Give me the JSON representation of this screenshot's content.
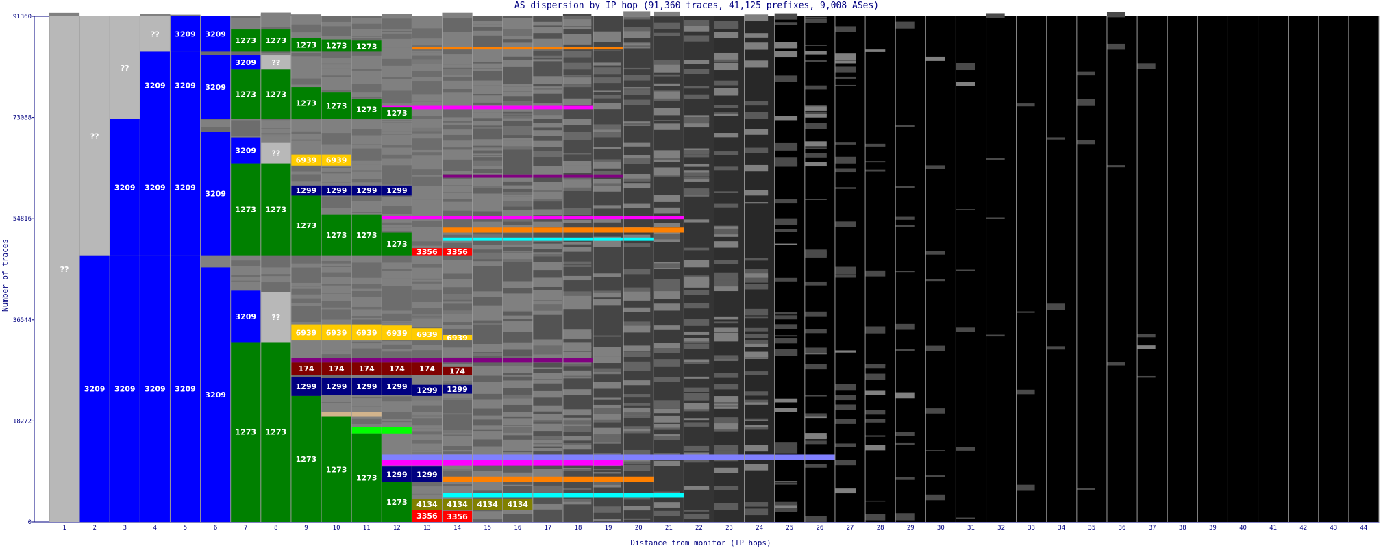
{
  "chart_data": {
    "type": "bar",
    "title": "AS dispersion by IP hop (91,360 traces, 41,125 prefixes, 9,008 ASes)",
    "xlabel": "Distance from monitor (IP hops)",
    "ylabel": "Number of traces",
    "ylim": [
      0,
      91360
    ],
    "y_ticks": [
      "0",
      "18272",
      "36544",
      "54816",
      "73088",
      "91360"
    ],
    "categories": [
      "1",
      "2",
      "3",
      "4",
      "5",
      "6",
      "7",
      "8",
      "9",
      "10",
      "11",
      "12",
      "13",
      "14",
      "15",
      "16",
      "17",
      "18",
      "19",
      "20",
      "21",
      "22",
      "23",
      "24",
      "25",
      "26",
      "27",
      "28",
      "29",
      "30",
      "31",
      "32",
      "33",
      "34",
      "35",
      "36",
      "37",
      "38",
      "39",
      "40",
      "41",
      "42",
      "43",
      "44"
    ],
    "colors": {
      "unknown": "#b8b8b8",
      "as3209": "#0000ff",
      "as1273": "#008000",
      "as6939": "#ffcc00",
      "as174": "#800000",
      "as1299": "#000080",
      "as4134": "#808000",
      "as3356": "#ff0000",
      "other_as": "#808080",
      "no_data": "#000000"
    },
    "labeled_segments": [
      {
        "hop": 1,
        "as": "??",
        "from": 0,
        "to": 91360
      },
      {
        "hop": 2,
        "as": "3209",
        "from": 0,
        "to": 48200
      },
      {
        "hop": 2,
        "as": "??",
        "from": 48200,
        "to": 91360
      },
      {
        "hop": 3,
        "as": "3209",
        "from": 0,
        "to": 48200
      },
      {
        "hop": 3,
        "as": "3209",
        "from": 48200,
        "to": 72800
      },
      {
        "hop": 3,
        "as": "??",
        "from": 72800,
        "to": 91360
      },
      {
        "hop": 4,
        "as": "3209",
        "from": 0,
        "to": 48200
      },
      {
        "hop": 4,
        "as": "3209",
        "from": 48200,
        "to": 72800
      },
      {
        "hop": 4,
        "as": "3209",
        "from": 72800,
        "to": 85000
      },
      {
        "hop": 4,
        "as": "??",
        "from": 85000,
        "to": 91360
      },
      {
        "hop": 5,
        "as": "3209",
        "from": 0,
        "to": 48200
      },
      {
        "hop": 5,
        "as": "3209",
        "from": 48200,
        "to": 72800
      },
      {
        "hop": 5,
        "as": "3209",
        "from": 72800,
        "to": 85000
      },
      {
        "hop": 5,
        "as": "3209",
        "from": 85000,
        "to": 91360
      },
      {
        "hop": 6,
        "as": "3209",
        "from": 0,
        "to": 46000
      },
      {
        "hop": 6,
        "as": "3209",
        "from": 48200,
        "to": 70500
      },
      {
        "hop": 6,
        "as": "3209",
        "from": 72800,
        "to": 84400
      },
      {
        "hop": 6,
        "as": "3209",
        "from": 85000,
        "to": 91360
      },
      {
        "hop": 7,
        "as": "1273",
        "from": 0,
        "to": 32500
      },
      {
        "hop": 7,
        "as": "3209",
        "from": 32500,
        "to": 41800
      },
      {
        "hop": 7,
        "as": "1273",
        "from": 48200,
        "to": 64800
      },
      {
        "hop": 7,
        "as": "3209",
        "from": 64800,
        "to": 69500
      },
      {
        "hop": 7,
        "as": "1273",
        "from": 72800,
        "to": 81800
      },
      {
        "hop": 7,
        "as": "3209",
        "from": 81800,
        "to": 84300
      },
      {
        "hop": 7,
        "as": "1273",
        "from": 85000,
        "to": 89000
      },
      {
        "hop": 8,
        "as": "1273",
        "from": 0,
        "to": 32500
      },
      {
        "hop": 8,
        "as": "??",
        "from": 32500,
        "to": 41500
      },
      {
        "hop": 8,
        "as": "1273",
        "from": 48200,
        "to": 64800
      },
      {
        "hop": 8,
        "as": "??",
        "from": 64800,
        "to": 68500
      },
      {
        "hop": 8,
        "as": "1273",
        "from": 72800,
        "to": 81800
      },
      {
        "hop": 8,
        "as": "??",
        "from": 81800,
        "to": 84300
      },
      {
        "hop": 8,
        "as": "1273",
        "from": 85000,
        "to": 89000
      },
      {
        "hop": 9,
        "as": "1273",
        "from": 0,
        "to": 22800
      },
      {
        "hop": 9,
        "as": "1299",
        "from": 22800,
        "to": 26200
      },
      {
        "hop": 9,
        "as": "174",
        "from": 26600,
        "to": 28800
      },
      {
        "hop": 9,
        "as": "6939",
        "from": 32800,
        "to": 35700
      },
      {
        "hop": 9,
        "as": "1273",
        "from": 48200,
        "to": 59000
      },
      {
        "hop": 9,
        "as": "1299",
        "from": 59000,
        "to": 60800
      },
      {
        "hop": 9,
        "as": "6939",
        "from": 64400,
        "to": 66400
      },
      {
        "hop": 9,
        "as": "1273",
        "from": 72800,
        "to": 78600
      },
      {
        "hop": 9,
        "as": "1273",
        "from": 85000,
        "to": 87400
      },
      {
        "hop": 10,
        "as": "1273",
        "from": 0,
        "to": 19000
      },
      {
        "hop": 10,
        "as": "1299",
        "from": 23000,
        "to": 26000
      },
      {
        "hop": 10,
        "as": "174",
        "from": 26600,
        "to": 28800
      },
      {
        "hop": 10,
        "as": "6939",
        "from": 32800,
        "to": 35700
      },
      {
        "hop": 10,
        "as": "1273",
        "from": 48200,
        "to": 55500
      },
      {
        "hop": 10,
        "as": "1299",
        "from": 59000,
        "to": 60800
      },
      {
        "hop": 10,
        "as": "6939",
        "from": 64400,
        "to": 66400
      },
      {
        "hop": 10,
        "as": "1273",
        "from": 72800,
        "to": 77600
      },
      {
        "hop": 10,
        "as": "1273",
        "from": 85000,
        "to": 87200
      },
      {
        "hop": 11,
        "as": "1273",
        "from": 0,
        "to": 16000
      },
      {
        "hop": 11,
        "as": "1299",
        "from": 23000,
        "to": 26000
      },
      {
        "hop": 11,
        "as": "174",
        "from": 26600,
        "to": 28800
      },
      {
        "hop": 11,
        "as": "6939",
        "from": 32800,
        "to": 35700
      },
      {
        "hop": 11,
        "as": "1273",
        "from": 48200,
        "to": 55500
      },
      {
        "hop": 11,
        "as": "1299",
        "from": 59000,
        "to": 60800
      },
      {
        "hop": 11,
        "as": "1273",
        "from": 72800,
        "to": 76400
      },
      {
        "hop": 11,
        "as": "1273",
        "from": 85000,
        "to": 87000
      },
      {
        "hop": 12,
        "as": "1273",
        "from": 0,
        "to": 7200
      },
      {
        "hop": 12,
        "as": "1299",
        "from": 7200,
        "to": 10000
      },
      {
        "hop": 12,
        "as": "1299",
        "from": 23000,
        "to": 26000
      },
      {
        "hop": 12,
        "as": "174",
        "from": 26600,
        "to": 28800
      },
      {
        "hop": 12,
        "as": "6939",
        "from": 32800,
        "to": 35500
      },
      {
        "hop": 12,
        "as": "1273",
        "from": 48200,
        "to": 52300
      },
      {
        "hop": 12,
        "as": "1299",
        "from": 59000,
        "to": 60800
      },
      {
        "hop": 12,
        "as": "1273",
        "from": 72800,
        "to": 75000
      },
      {
        "hop": 13,
        "as": "3356",
        "from": 0,
        "to": 2200
      },
      {
        "hop": 13,
        "as": "4134",
        "from": 2200,
        "to": 4200
      },
      {
        "hop": 13,
        "as": "1299",
        "from": 7200,
        "to": 10000
      },
      {
        "hop": 13,
        "as": "1299",
        "from": 22800,
        "to": 24800
      },
      {
        "hop": 13,
        "as": "174",
        "from": 26600,
        "to": 28800
      },
      {
        "hop": 13,
        "as": "6939",
        "from": 32800,
        "to": 35000
      },
      {
        "hop": 13,
        "as": "3356",
        "from": 48200,
        "to": 49500
      },
      {
        "hop": 14,
        "as": "3356",
        "from": 0,
        "to": 2000
      },
      {
        "hop": 14,
        "as": "4134",
        "from": 2200,
        "to": 4200
      },
      {
        "hop": 14,
        "as": "1299",
        "from": 23200,
        "to": 24800
      },
      {
        "hop": 14,
        "as": "174",
        "from": 26600,
        "to": 28000
      },
      {
        "hop": 14,
        "as": "6939",
        "from": 32800,
        "to": 33800
      },
      {
        "hop": 14,
        "as": "3356",
        "from": 48200,
        "to": 49500
      },
      {
        "hop": 15,
        "as": "4134",
        "from": 2200,
        "to": 4200
      },
      {
        "hop": 16,
        "as": "4134",
        "from": 2200,
        "to": 4200
      }
    ],
    "accent_bands": [
      {
        "hop_from": 9,
        "hop_to": 19,
        "color": "#ff00ff",
        "from": 10200,
        "to": 11200
      },
      {
        "hop_from": 12,
        "hop_to": 26,
        "color": "#8080ff",
        "from": 11200,
        "to": 12200
      },
      {
        "hop_from": 14,
        "hop_to": 20,
        "color": "#ff8000",
        "from": 7200,
        "to": 8200
      },
      {
        "hop_from": 14,
        "hop_to": 21,
        "color": "#00ffff",
        "from": 4400,
        "to": 5200
      },
      {
        "hop_from": 11,
        "hop_to": 12,
        "color": "#00ff00",
        "from": 16000,
        "to": 17200
      },
      {
        "hop_from": 10,
        "hop_to": 11,
        "color": "#d2b48c",
        "from": 19000,
        "to": 19900
      },
      {
        "hop_from": 12,
        "hop_to": 21,
        "color": "#ff00ff",
        "from": 54700,
        "to": 55300
      },
      {
        "hop_from": 14,
        "hop_to": 21,
        "color": "#ff8000",
        "from": 52300,
        "to": 53200
      },
      {
        "hop_from": 14,
        "hop_to": 20,
        "color": "#00ffff",
        "from": 50800,
        "to": 51400
      },
      {
        "hop_from": 14,
        "hop_to": 19,
        "color": "#800080",
        "from": 62200,
        "to": 62800
      },
      {
        "hop_from": 9,
        "hop_to": 18,
        "color": "#800080",
        "from": 28800,
        "to": 29600
      },
      {
        "hop_from": 12,
        "hop_to": 18,
        "color": "#ff00ff",
        "from": 74600,
        "to": 75200
      },
      {
        "hop_from": 13,
        "hop_to": 19,
        "color": "#ff8000",
        "from": 85400,
        "to": 85800
      }
    ],
    "gray_extent_top": [
      91360,
      91360,
      91360,
      91360,
      91360,
      91360,
      91360,
      91360,
      91360,
      91360,
      91360,
      91360,
      91360,
      91360,
      91360,
      91360,
      91360,
      91360,
      91360,
      91360,
      91360,
      91360,
      91360,
      91360,
      91360,
      91360,
      91360,
      91360,
      91360,
      91360,
      91360,
      91360,
      0,
      0,
      0,
      0,
      0,
      0,
      0,
      0,
      0,
      0,
      0,
      0
    ],
    "gray_fraction": [
      1,
      1,
      1,
      1,
      1,
      1,
      1,
      1,
      1,
      1,
      1,
      1,
      0.95,
      0.9,
      0.85,
      0.8,
      0.72,
      0.65,
      0.6,
      0.55,
      0.5,
      0.45,
      0.4,
      0.35,
      0.3,
      0.24,
      0.18,
      0.12,
      0.09,
      0.07,
      0.05,
      0.03,
      0.02,
      0.015,
      0.01,
      0.008,
      0.005,
      0,
      0,
      0,
      0,
      0,
      0,
      0
    ],
    "grid": true,
    "legend": "none"
  }
}
